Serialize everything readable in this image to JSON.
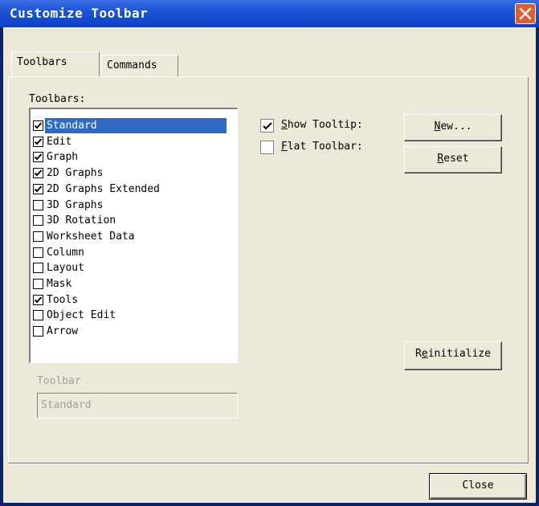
{
  "window": {
    "title": "Customize Toolbar"
  },
  "tabs": [
    {
      "label": "Toolbars",
      "active": true
    },
    {
      "label": "Commands",
      "active": false
    }
  ],
  "toolbars_section": {
    "label": "Toolbars",
    "items": [
      {
        "label": "Standard",
        "checked": true,
        "selected": true
      },
      {
        "label": "Edit",
        "checked": true,
        "selected": false
      },
      {
        "label": "Graph",
        "checked": true,
        "selected": false
      },
      {
        "label": "2D Graphs",
        "checked": true,
        "selected": false
      },
      {
        "label": "2D Graphs Extended",
        "checked": true,
        "selected": false
      },
      {
        "label": "3D Graphs",
        "checked": false,
        "selected": false
      },
      {
        "label": "3D Rotation",
        "checked": false,
        "selected": false
      },
      {
        "label": "Worksheet Data",
        "checked": false,
        "selected": false
      },
      {
        "label": "Column",
        "checked": false,
        "selected": false
      },
      {
        "label": "Layout",
        "checked": false,
        "selected": false
      },
      {
        "label": "Mask",
        "checked": false,
        "selected": false
      },
      {
        "label": "Tools",
        "checked": true,
        "selected": false
      },
      {
        "label": "Object Edit",
        "checked": false,
        "selected": false
      },
      {
        "label": "Arrow",
        "checked": false,
        "selected": false
      }
    ]
  },
  "options": {
    "show_tooltip": {
      "label_prefix": "",
      "underline": "S",
      "label_rest": "how Tooltip:",
      "checked": true
    },
    "flat_toolbar": {
      "underline": "F",
      "label_rest": "lat Toolbar:",
      "checked": false
    }
  },
  "buttons": {
    "new": {
      "underline": "N",
      "rest": "ew..."
    },
    "reset": {
      "underline": "R",
      "rest": "eset"
    },
    "reinitialize": {
      "prefix": "R",
      "underline": "e",
      "rest": "initialize"
    },
    "close": "Close"
  },
  "toolbar_name": {
    "label": "Toolbar",
    "value": "Standard"
  }
}
